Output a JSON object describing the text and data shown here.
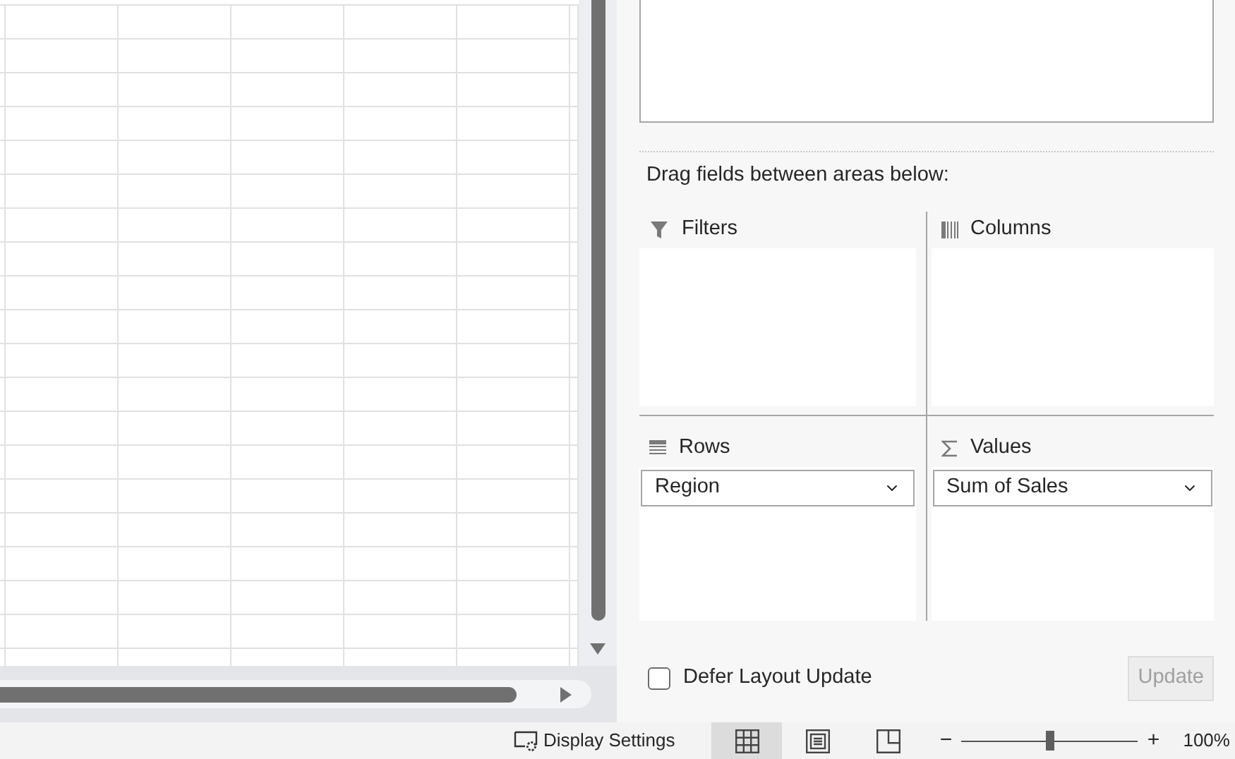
{
  "pivot_pane": {
    "instruction": "Drag fields between areas below:",
    "areas": [
      {
        "kind": "filters",
        "title": "Filters"
      },
      {
        "kind": "columns",
        "title": "Columns"
      },
      {
        "kind": "rows",
        "title": "Rows",
        "fields": [
          "Region"
        ]
      },
      {
        "kind": "values",
        "title": "Values",
        "fields": [
          "Sum of Sales"
        ]
      }
    ],
    "defer_layout_update": {
      "label": "Defer Layout Update",
      "checked": false
    },
    "update_button": {
      "label": "Update",
      "disabled": true
    }
  },
  "status_bar": {
    "display_settings": "Display Settings",
    "views": [
      {
        "kind": "normal",
        "selected": true
      },
      {
        "kind": "page_layout",
        "selected": false
      },
      {
        "kind": "page_break",
        "selected": false
      }
    ],
    "zoom": {
      "minus": "−",
      "plus": "+",
      "level": 0.5,
      "reading": "100%"
    }
  }
}
